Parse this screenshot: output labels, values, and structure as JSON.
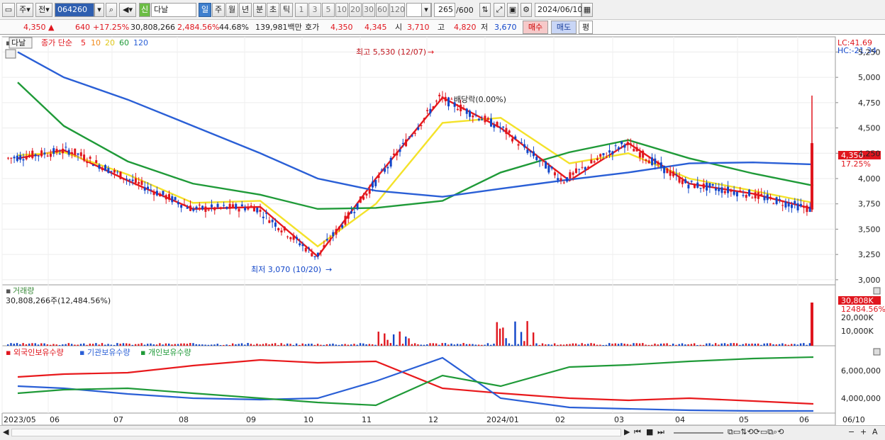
{
  "toolbar": {
    "market": "주",
    "prev_label": "전",
    "code": "064260",
    "new_badge": "신",
    "stock_name": "다날",
    "periods": [
      "일",
      "주",
      "월",
      "년",
      "분",
      "초",
      "틱"
    ],
    "active_period": "일",
    "intervals": [
      "1",
      "3",
      "5",
      "10",
      "20",
      "30",
      "60",
      "120"
    ],
    "count_value": "265",
    "count_total": "/600",
    "date": "2024/06/10"
  },
  "quote": {
    "price": "4,350",
    "arrow": "▲",
    "change": "640",
    "change_pct": "+17.25%",
    "volume": "30,808,266",
    "volume_pct": "2,484.56%",
    "turnover_pct": "44.68%",
    "amount": "139,981백만",
    "hoga_label": "호가",
    "ask": "4,350",
    "bid": "4,345",
    "open_label": "시",
    "open": "3,710",
    "high_label": "고",
    "high": "4,820",
    "low_label": "저",
    "low": "3,670",
    "buy_label": "매수",
    "sell_label": "매도",
    "eval_label": "평"
  },
  "price_panel": {
    "name_tag": "다날",
    "ma_title": "종가 단순",
    "ma_periods": [
      "5",
      "10",
      "20",
      "60",
      "120"
    ],
    "ma_colors": [
      "#e8191c",
      "#f08a1a",
      "#f4e22a",
      "#1f9a38",
      "#2a5fd6"
    ],
    "lc": "LC:41.69",
    "hc": "HC:-21.34",
    "y_ticks": [
      "5,250",
      "5,000",
      "4,750",
      "4,500",
      "4,250",
      "4,000",
      "3,750",
      "3,500",
      "3,250",
      "3,000"
    ],
    "high_annot": "최고 5,530 (12/07)",
    "low_annot": "최저 3,070 (10/20)",
    "div_annot": "배당락(0.00%)",
    "current_tag": "4,350",
    "current_pct": "17.25%"
  },
  "volume_panel": {
    "title": "거래량",
    "value_text": "30,808,266주(12,484.56%)",
    "y_ticks": [
      "20,000K",
      "10,000K"
    ],
    "current_tag": "30,808K",
    "current_pct": "12484.56%"
  },
  "holding_panel": {
    "legend": [
      "외국인보유수량",
      "기관보유수량",
      "개인보유수량"
    ],
    "colors": [
      "#e8191c",
      "#2a5fd6",
      "#1f9a38"
    ],
    "y_ticks": [
      "6,000,000",
      "4,000,000"
    ]
  },
  "x_axis": {
    "labels": [
      "2023/05",
      "06",
      "07",
      "08",
      "09",
      "10",
      "11",
      "12",
      "2024/01",
      "02",
      "03",
      "04",
      "05",
      "06"
    ],
    "end_label": "06/10"
  },
  "chart_data": {
    "type": "line",
    "title": "다날",
    "x": [
      "2023/05",
      "06",
      "07",
      "08",
      "09",
      "10",
      "11",
      "12",
      "2024/01",
      "02",
      "03",
      "04",
      "05",
      "06"
    ],
    "ylim": [
      2950,
      5400
    ],
    "series": [
      {
        "name": "5",
        "values": [
          4200,
          4280,
          3980,
          3700,
          3720,
          3230,
          4000,
          4800,
          4500,
          3980,
          4350,
          3950,
          3850,
          3700
        ]
      },
      {
        "name": "20",
        "values": [
          4230,
          4260,
          4040,
          3760,
          3780,
          3330,
          3750,
          4550,
          4600,
          4150,
          4250,
          4000,
          3880,
          3760
        ]
      },
      {
        "name": "60",
        "values": [
          4950,
          4520,
          4170,
          3950,
          3840,
          3700,
          3710,
          3780,
          4060,
          4260,
          4380,
          4200,
          4050,
          3930
        ]
      },
      {
        "name": "120",
        "values": [
          5250,
          5000,
          4780,
          4520,
          4250,
          4000,
          3880,
          3820,
          3900,
          3990,
          4060,
          4150,
          4160,
          4140
        ]
      }
    ],
    "highest": {
      "value": 5530,
      "date": "12/07"
    },
    "lowest": {
      "value": 3070,
      "date": "10/20"
    },
    "current": 4350
  }
}
